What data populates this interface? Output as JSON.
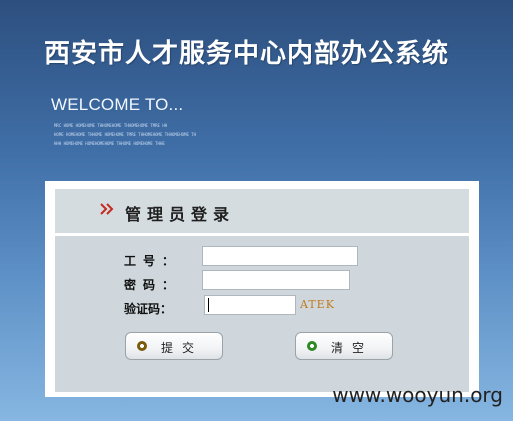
{
  "app": {
    "title": "西安市人才服务中心内部办公系统",
    "welcome": "WELCOME TO...",
    "subtitle_lines": [
      "MRC HOME HOMEHOME THHOMEHOME THHOMEHOME TMRE HH",
      "HOME HOMEHOME THHOME HOMEHOME TMRE THHOMEHOME THHOMEHOME TH",
      "HHH HOMEHOME HOMEHOMEHOME THHOME HOMEHOME THHE"
    ]
  },
  "login": {
    "heading": "管理员登录",
    "employee_id_label": "工号：",
    "password_label": "密码：",
    "captcha_label": "验证码：",
    "employee_id_value": "",
    "password_value": "",
    "captcha_value": "",
    "captcha_text": "ATEK",
    "submit_label": "提交",
    "clear_label": "清空"
  },
  "watermark": "www.wooyun.org",
  "colors": {
    "background_top": "#2d4f7f",
    "background_bottom": "#86b6e1",
    "panel": "#cfd7dc",
    "chevron": "#c52b1f"
  },
  "icons": {
    "heading_icon": "double-chevron-right-icon",
    "submit_icon": "radio-dot-icon",
    "clear_icon": "radio-dot-icon"
  }
}
